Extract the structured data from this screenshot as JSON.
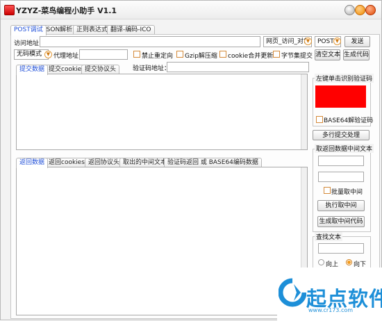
{
  "window": {
    "title": "YZYZ-菜鸟编程小助手 V1.1"
  },
  "main_tabs": [
    "POST调试",
    "JSON解析",
    "正则表达式",
    "翻译-编码-ICO"
  ],
  "url_row": {
    "label": "访问地址：",
    "method_combo": "网页_访问_对象",
    "verb_combo": "POST",
    "send_button": "发送"
  },
  "options_row": {
    "mode_combo": "无码模式",
    "proxy_label": "代理地址：",
    "chk_no_redirect": "禁止重定向",
    "chk_gzip": "Gzip解压缩",
    "chk_cookie_merge": "cookie合并更新",
    "chk_byte_submit": "字节集提交",
    "clear_button": "清空文本",
    "gen_code_button": "生成代码"
  },
  "submit_tabs": [
    "提交数据",
    "提交cookie",
    "提交协议头"
  ],
  "captcha_label": "验证码地址：",
  "captcha_group": {
    "title": "左键单击识别验证码",
    "chk_base64": "BASE64解验证码",
    "color": "#ff0000"
  },
  "multi_submit_button": "多行提交处理",
  "extract_group": {
    "title": "取返回数据中间文本",
    "chk_batch": "批量取中间",
    "exec_button": "执行取中间",
    "gen_button": "生成取中间代码"
  },
  "find_group": {
    "title": "查找文本",
    "radio_up": "向上",
    "radio_down": "向下"
  },
  "return_tabs": [
    "返回数据",
    "返回cookies",
    "返回协议头",
    "取出的中间文本",
    "验证码返回 或 BASE64编码数据"
  ],
  "watermark": {
    "text": "起点软件",
    "sub": "www.cr173.com"
  }
}
